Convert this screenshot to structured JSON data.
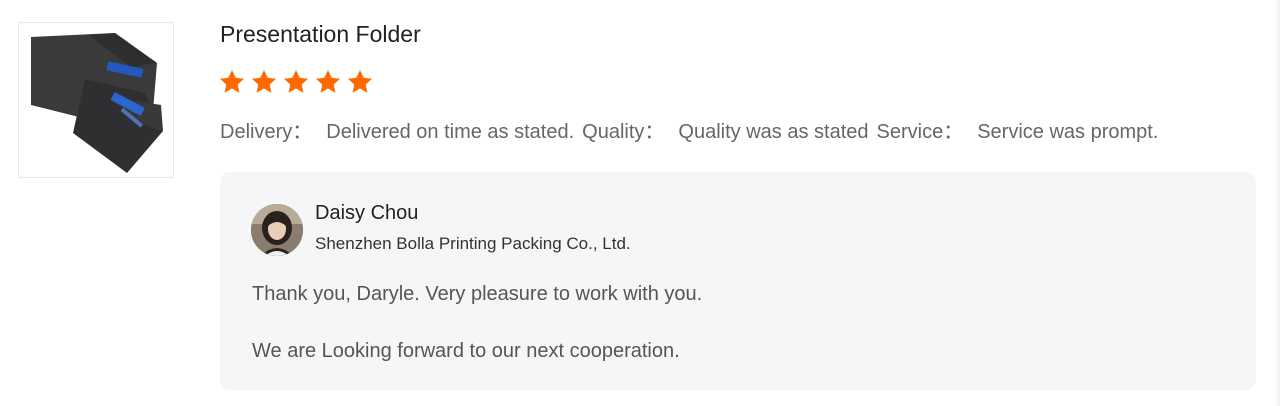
{
  "product": {
    "title": "Presentation Folder",
    "rating": 5,
    "rating_max": 5,
    "star_color": "#ff6a00",
    "image_icon": "presentation-folder-image"
  },
  "attributes": [
    {
      "label": "Delivery：",
      "value": "Delivered on time as stated."
    },
    {
      "label": "Quality：",
      "value": "Quality was as stated"
    },
    {
      "label": "Service：",
      "value": "Service was prompt."
    }
  ],
  "reply": {
    "name": "Daisy Chou",
    "company": "Shenzhen Bolla Printing Packing Co., Ltd.",
    "avatar_icon": "seller-avatar",
    "lines": [
      "Thank you, Daryle. Very pleasure to work with you.",
      "We are Looking forward to our next cooperation."
    ],
    "background": "#f5f6f8"
  }
}
